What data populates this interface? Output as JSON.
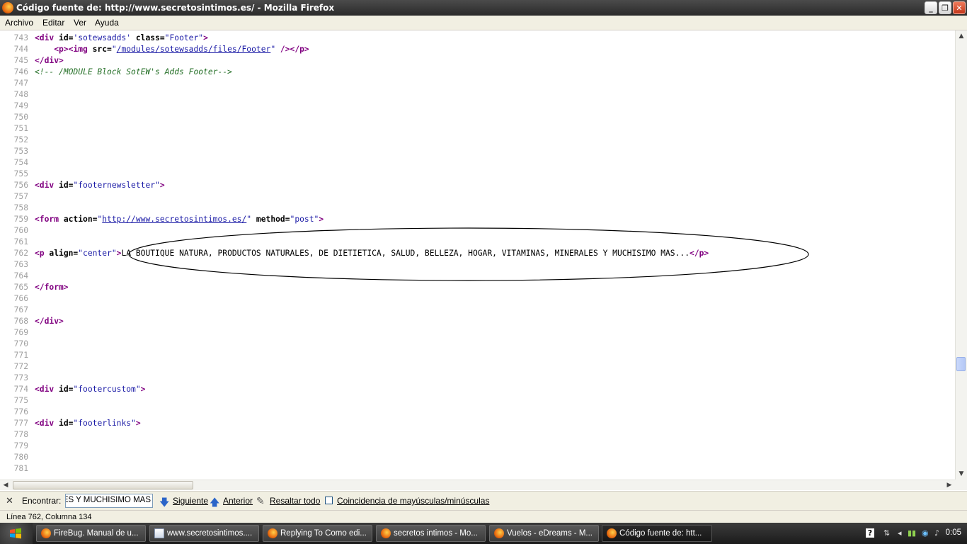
{
  "window": {
    "title": "Código fuente de: http://www.secretosintimos.es/ - Mozilla Firefox",
    "buttons": {
      "minimize": "_",
      "maximize": "❐",
      "close": "✕"
    }
  },
  "menu": [
    "Archivo",
    "Editar",
    "Ver",
    "Ayuda"
  ],
  "source_lines": [
    {
      "n": "743",
      "parts": [
        [
          "tag",
          "<div"
        ],
        [
          "attr",
          " id="
        ],
        [
          "val",
          "'sotewsadds'"
        ],
        [
          "attr",
          " class="
        ],
        [
          "val",
          "\"Footer\""
        ],
        [
          "tag",
          ">"
        ]
      ]
    },
    {
      "n": "744",
      "parts": [
        [
          "txt",
          "    "
        ],
        [
          "tag",
          "<p><img"
        ],
        [
          "attr",
          " src="
        ],
        [
          "val",
          "\""
        ],
        [
          "lnk",
          "/modules/sotewsadds/files/Footer"
        ],
        [
          "val",
          "\""
        ],
        [
          "tag",
          " /></p>"
        ]
      ]
    },
    {
      "n": "745",
      "parts": [
        [
          "tag",
          "</div>"
        ]
      ]
    },
    {
      "n": "746",
      "parts": [
        [
          "cmt",
          "<!-- /MODULE Block SotEW's Adds Footer-->"
        ]
      ]
    },
    {
      "n": "747",
      "parts": []
    },
    {
      "n": "748",
      "parts": []
    },
    {
      "n": "749",
      "parts": []
    },
    {
      "n": "750",
      "parts": []
    },
    {
      "n": "751",
      "parts": []
    },
    {
      "n": "752",
      "parts": []
    },
    {
      "n": "753",
      "parts": []
    },
    {
      "n": "754",
      "parts": []
    },
    {
      "n": "755",
      "parts": []
    },
    {
      "n": "756",
      "parts": [
        [
          "tag",
          "<div"
        ],
        [
          "attr",
          " id="
        ],
        [
          "val",
          "\"footernewsletter\""
        ],
        [
          "tag",
          ">"
        ]
      ]
    },
    {
      "n": "757",
      "parts": []
    },
    {
      "n": "758",
      "parts": []
    },
    {
      "n": "759",
      "parts": [
        [
          "tag",
          "<form"
        ],
        [
          "attr",
          " action="
        ],
        [
          "val",
          "\""
        ],
        [
          "lnk",
          "http://www.secretosintimos.es/"
        ],
        [
          "val",
          "\""
        ],
        [
          "attr",
          " method="
        ],
        [
          "val",
          "\"post\""
        ],
        [
          "tag",
          ">"
        ]
      ]
    },
    {
      "n": "760",
      "parts": []
    },
    {
      "n": "761",
      "parts": []
    },
    {
      "n": "762",
      "parts": [
        [
          "tag",
          "<p"
        ],
        [
          "attr",
          " align="
        ],
        [
          "val",
          "\"center\""
        ],
        [
          "tag",
          ">"
        ],
        [
          "txt",
          "LA BOUTIQUE NATURA, PRODUCTOS NATURALES, DE DIETIETICA, SALUD, BELLEZA, HOGAR, VITAMINAS, MINERALES Y MUCHISIMO MAS..."
        ],
        [
          "tag",
          "</p>"
        ]
      ]
    },
    {
      "n": "763",
      "parts": []
    },
    {
      "n": "764",
      "parts": []
    },
    {
      "n": "765",
      "parts": [
        [
          "tag",
          "</form>"
        ]
      ]
    },
    {
      "n": "766",
      "parts": []
    },
    {
      "n": "767",
      "parts": []
    },
    {
      "n": "768",
      "parts": [
        [
          "tag",
          "</div>"
        ]
      ]
    },
    {
      "n": "769",
      "parts": []
    },
    {
      "n": "770",
      "parts": []
    },
    {
      "n": "771",
      "parts": []
    },
    {
      "n": "772",
      "parts": []
    },
    {
      "n": "773",
      "parts": []
    },
    {
      "n": "774",
      "parts": [
        [
          "tag",
          "<div"
        ],
        [
          "attr",
          " id="
        ],
        [
          "val",
          "\"footercustom\""
        ],
        [
          "tag",
          ">"
        ]
      ]
    },
    {
      "n": "775",
      "parts": []
    },
    {
      "n": "776",
      "parts": []
    },
    {
      "n": "777",
      "parts": [
        [
          "tag",
          "<div"
        ],
        [
          "attr",
          " id="
        ],
        [
          "val",
          "\"footerlinks\""
        ],
        [
          "tag",
          ">"
        ]
      ]
    },
    {
      "n": "778",
      "parts": []
    },
    {
      "n": "779",
      "parts": []
    },
    {
      "n": "780",
      "parts": []
    },
    {
      "n": "781",
      "parts": []
    }
  ],
  "findbar": {
    "close": "✕",
    "label": "Encontrar:",
    "value": "ALES Y MUCHISIMO MAS",
    "next": "Siguiente",
    "prev": "Anterior",
    "highlight": "Resaltar todo",
    "match_case": "Coincidencia de mayúsculas/minúsculas"
  },
  "status": "Línea 762, Columna 134",
  "taskbar": {
    "tasks": [
      {
        "label": "FireBug. Manual de u...",
        "icon": "firefox"
      },
      {
        "label": "www.secretosintimos....",
        "icon": "doc"
      },
      {
        "label": "Replying To Como edi...",
        "icon": "firefox"
      },
      {
        "label": "secretos intimos - Mo...",
        "icon": "firefox"
      },
      {
        "label": "Vuelos - eDreams - M...",
        "icon": "firefox"
      },
      {
        "label": "Código fuente de: htt...",
        "icon": "firefox"
      }
    ],
    "clock": "0:05",
    "help": "?"
  }
}
